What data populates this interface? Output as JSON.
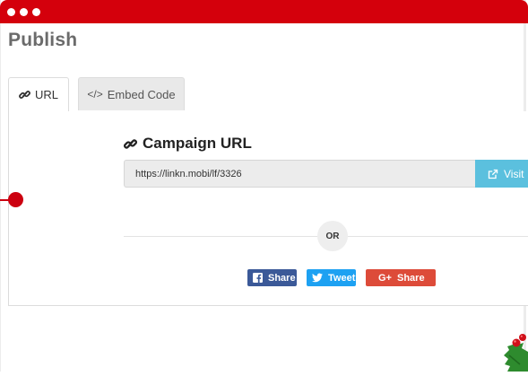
{
  "window": {
    "accent_color": "#d4000c"
  },
  "page": {
    "title": "Publish"
  },
  "tabs": [
    {
      "label": "URL",
      "icon": "link-icon",
      "active": true
    },
    {
      "label": "Embed Code",
      "icon": "code-icon",
      "active": false
    }
  ],
  "campaign": {
    "title": "Campaign URL",
    "url": "https://linkn.mobi/lf/3326",
    "visit_label": "Visit"
  },
  "divider": {
    "or_label": "OR"
  },
  "share": {
    "facebook_label": "Share",
    "twitter_label": "Tweet",
    "google_label": "Share",
    "colors": {
      "facebook": "#3b5998",
      "twitter": "#1da1f2",
      "google": "#dd4b39"
    }
  }
}
